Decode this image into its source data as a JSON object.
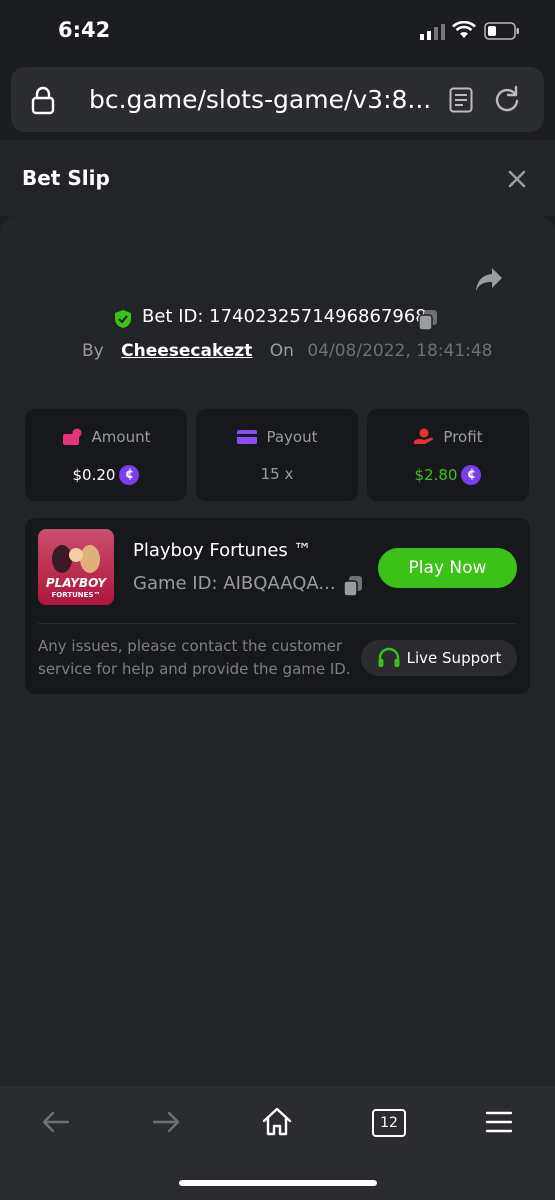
{
  "status_bar": {
    "time": "6:42"
  },
  "browser": {
    "url": "bc.game/slots-game/v3:8..."
  },
  "header": {
    "title": "Bet Slip"
  },
  "bet": {
    "id_text": "Bet ID: 1740232571496867968",
    "by_label": "By",
    "username": "Cheesecakezt",
    "on_label": "On",
    "datetime": "04/08/2022, 18:41:48"
  },
  "stats": [
    {
      "label": "Amount",
      "value": "$0.20",
      "icon": "wallet-icon",
      "color": "#ffffff"
    },
    {
      "label": "Payout",
      "value": "15 x",
      "icon": "card-icon",
      "color": "#9a9ca2"
    },
    {
      "label": "Profit",
      "value": "$2.80",
      "icon": "hand-coin-icon",
      "color": "#3bc117"
    }
  ],
  "currency_glyph": "¢",
  "game": {
    "name": "Playboy Fortunes ™",
    "id_text": "Game ID: AIBQAAQA...",
    "thumb_line1": "PLAYBOY",
    "thumb_line2": "FORTUNES™",
    "play_label": "Play Now",
    "note": "Any issues, please contact the customer service for help and provide the game ID.",
    "support_label": "Live Support"
  },
  "toolbar": {
    "tabs_count": "12"
  },
  "colors": {
    "accent_green": "#3bc117",
    "coin_purple": "#7a3df0",
    "panel_bg": "#232427"
  }
}
